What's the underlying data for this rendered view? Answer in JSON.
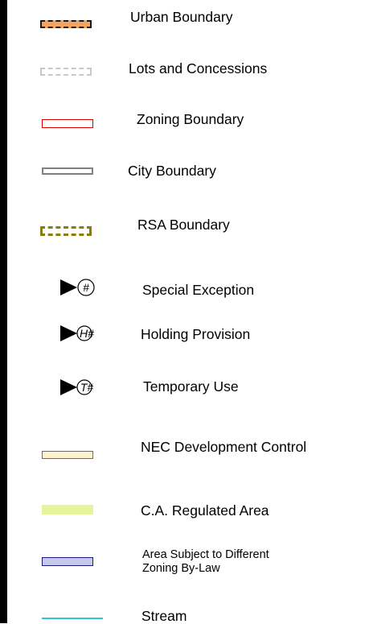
{
  "legend": {
    "items": [
      {
        "id": "urban",
        "label": "Urban Boundary"
      },
      {
        "id": "lots",
        "label": "Lots and Concessions"
      },
      {
        "id": "zoning",
        "label": "Zoning Boundary"
      },
      {
        "id": "city",
        "label": "City Boundary"
      },
      {
        "id": "rsa",
        "label": "RSA Boundary"
      },
      {
        "id": "special",
        "label": "Special Exception",
        "symbol_text": "#"
      },
      {
        "id": "holding",
        "label": "Holding Provision",
        "symbol_text": "H#"
      },
      {
        "id": "temporary",
        "label": "Temporary Use",
        "symbol_text": "T#"
      },
      {
        "id": "nec",
        "label": "NEC Development Control"
      },
      {
        "id": "ca",
        "label": "C.A. Regulated Area"
      },
      {
        "id": "area",
        "label_line1": "Area Subject to Different",
        "label_line2": "Zoning  By-Law"
      },
      {
        "id": "stream",
        "label": "Stream"
      }
    ],
    "colors": {
      "urban_fill": "#f4a460",
      "lots_outline": "#c8c8c8",
      "zoning_outline": "#e00000",
      "city_outline": "#808080",
      "rsa_outline": "#8b7d0a",
      "nec_fill": "#fdf2cc",
      "ca_fill": "#e4f59a",
      "area_fill": "#c8c8ef",
      "stream_line": "#30c8d6"
    }
  }
}
